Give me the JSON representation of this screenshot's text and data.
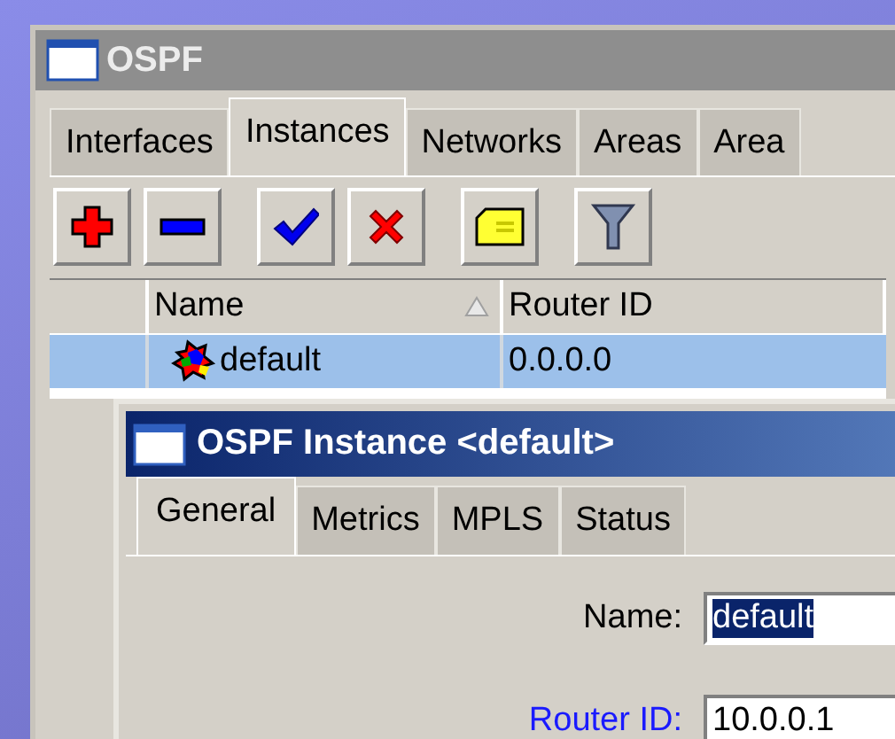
{
  "window": {
    "title": "OSPF"
  },
  "tabs": [
    {
      "label": "Interfaces",
      "selected": false
    },
    {
      "label": "Instances",
      "selected": true
    },
    {
      "label": "Networks",
      "selected": false
    },
    {
      "label": "Areas",
      "selected": false
    },
    {
      "label": "Area",
      "selected": false
    }
  ],
  "table": {
    "columns": [
      {
        "label": "Name",
        "sorted": true
      },
      {
        "label": "Router ID",
        "sorted": false
      }
    ],
    "rows": [
      {
        "name": "default",
        "router_id": "0.0.0.0",
        "selected": true
      }
    ]
  },
  "dialog": {
    "title": "OSPF Instance <default>",
    "tabs": [
      {
        "label": "General",
        "selected": true
      },
      {
        "label": "Metrics",
        "selected": false
      },
      {
        "label": "MPLS",
        "selected": false
      },
      {
        "label": "Status",
        "selected": false
      }
    ],
    "fields": [
      {
        "label": "Name:",
        "kind": "plain",
        "value": "default",
        "value_selected": true
      },
      {
        "label": "Router ID:",
        "kind": "optional",
        "value": "10.0.0.1",
        "value_selected": false
      }
    ]
  }
}
